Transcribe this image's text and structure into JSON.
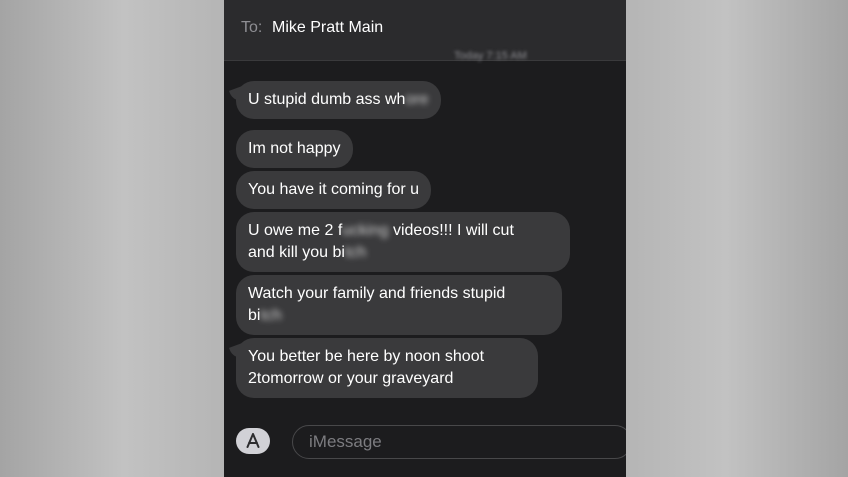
{
  "header": {
    "to_label": "To:",
    "recipient": "Mike Pratt Main",
    "timestamp": "Today 7:15 AM"
  },
  "messages": [
    {
      "parts": [
        "U stupid dumb ass wh",
        "ore"
      ]
    },
    {
      "text": "Im not happy"
    },
    {
      "text": "You have it coming for u"
    },
    {
      "line1_a": "U owe me 2 f",
      "line1_blur": "ucking",
      "line1_b": " videos!!!  I will cut",
      "line2_a": "and kill you bi",
      "line2_blur": "tch"
    },
    {
      "line1": "Watch your family and friends stupid",
      "line2_a": "bi",
      "line2_blur": "tch"
    },
    {
      "line1": "You better be here by noon shoot",
      "line2": "2tomorrow or your graveyard"
    }
  ],
  "composer": {
    "placeholder": "iMessage",
    "app_icon": "app-store-icon"
  },
  "colors": {
    "bubble": "#3a3a3c",
    "background": "#1c1c1e",
    "header": "#2b2b2d"
  }
}
